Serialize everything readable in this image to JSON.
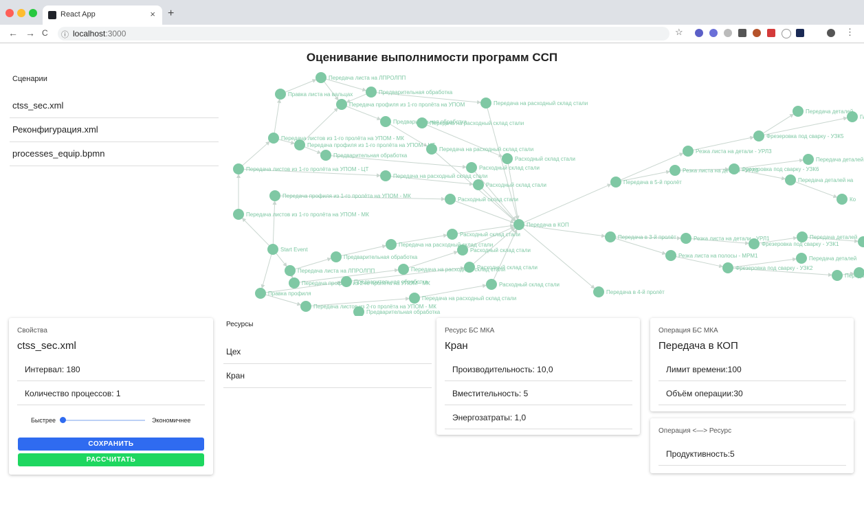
{
  "browser": {
    "tab_title": "React App",
    "url_host": "localhost",
    "url_port": ":3000",
    "tab_close": "×",
    "new_tab": "+",
    "back": "←",
    "forward": "→",
    "reload": "C",
    "info": "ⓘ",
    "star": "☆",
    "menu": "⋮"
  },
  "page": {
    "title": "Оценивание выполнимости программ ССП"
  },
  "scenarios": {
    "heading": "Сценарии",
    "items": [
      "ctss_sec.xml",
      "Реконфигурация.xml",
      "processes_equip.bpmn"
    ]
  },
  "graph": {
    "color": "#7fc8a4",
    "nodes": [
      {
        "label": "Передача листа на ЛПРОЛПП"
      },
      {
        "label": "Правка листа на вальцах"
      },
      {
        "label": "Предварительная обработка"
      },
      {
        "label": "Передача профиля из 1-го пролёта на УПОМ"
      },
      {
        "label": "Передача на расходный склад стали"
      },
      {
        "label": "Предварительная обработка"
      },
      {
        "label": "Передача на расходный склад стали"
      },
      {
        "label": "Передача листов из 1-го пролёта на УПОМ - МК"
      },
      {
        "label": "Передача профиля из 1-го пролёта на УПОМ - ЦТ"
      },
      {
        "label": "Предварительная обработка"
      },
      {
        "label": "Передача на расходный склад стали"
      },
      {
        "label": "Расходный склад стали"
      },
      {
        "label": "Расходный склад стали"
      },
      {
        "label": "Передача листов из 1-го пролёта на УПОМ - ЦТ"
      },
      {
        "label": "Передача на расходный склад стали"
      },
      {
        "label": "Расходный склад стали"
      },
      {
        "label": "Передача профиля из 1-го пролёта на УПОМ - МК"
      },
      {
        "label": "Расходный склад стали"
      },
      {
        "label": "Передача листов из 1-го пролёта на УПОМ - МК"
      },
      {
        "label": "Передача в КОП"
      },
      {
        "label": "Start Event"
      },
      {
        "label": "Расходный склад стали"
      },
      {
        "label": "Передача на расходный склад стали"
      },
      {
        "label": "Расходный склад стали"
      },
      {
        "label": "Предварительная обработка"
      },
      {
        "label": "Передача листа на ЛПРОЛПП"
      },
      {
        "label": "Передача на расходный склад стали"
      },
      {
        "label": "Расходный склад стали"
      },
      {
        "label": "Передача профиля из 2-го пролёта на УПОМ - МК"
      },
      {
        "label": "Предварительная обработка"
      },
      {
        "label": "Правка профиля"
      },
      {
        "label": "Расходный склад стали"
      },
      {
        "label": "Передача на расходный склад стали"
      },
      {
        "label": "Передача листов из 2-го пролёта на УПОМ - МК"
      },
      {
        "label": "Предварительная обработка"
      },
      {
        "label": "Передача в 5-й пролёт"
      },
      {
        "label": "Резка листа на детали - УРЛ3"
      },
      {
        "label": "Резка листа на детали - УРЛ2"
      },
      {
        "label": "Фрезеровка под сварку - УЗК5"
      },
      {
        "label": "Фрезеровка под сварку - УЗК6"
      },
      {
        "label": "Передача деталей"
      },
      {
        "label": "Передача деталей"
      },
      {
        "label": "Передача деталей на"
      },
      {
        "label": "Ко"
      },
      {
        "label": "Гиб"
      },
      {
        "label": "Передача в 3-й пролёт"
      },
      {
        "label": "Резка листа на детали - УРЛ1"
      },
      {
        "label": "Резка листа на полосы - МРМ1"
      },
      {
        "label": "Фрезеровка под сварку - УЗК1"
      },
      {
        "label": "Фрезеровка под сварку - УЗК2"
      },
      {
        "label": "Передача деталей"
      },
      {
        "label": "Передача деталей"
      },
      {
        "label": "Передача деталей на У"
      },
      {
        "label": "Ги"
      },
      {
        "label": "Ком"
      },
      {
        "label": "Передача в 4-й пролёт"
      }
    ]
  },
  "properties": {
    "caption": "Свойства",
    "title": "ctss_sec.xml",
    "interval": "Интервал: 180",
    "process_count": "Количество процессов: 1",
    "slider_left": "Быстрее",
    "slider_right": "Экономичнее",
    "slider_value": 0,
    "save_label": "СОХРАНИТЬ",
    "calc_label": "РАССЧИТАТЬ",
    "save_color": "#2f6bf0",
    "calc_color": "#1ed760"
  },
  "resources": {
    "heading": "Ресурсы",
    "items": [
      "Цех",
      "Кран"
    ]
  },
  "resource_detail": {
    "caption": "Ресурс БС МКА",
    "title": "Кран",
    "rows": [
      "Производительность: 10,0",
      "Вместительность: 5",
      "Энергозатраты: 1,0"
    ]
  },
  "operation": {
    "caption": "Операция БС МКА",
    "title": "Передача в КОП",
    "rows": [
      "Лимит времени:100",
      "Объём операции:30"
    ]
  },
  "op_resource": {
    "caption": "Операция <—> Ресурс",
    "rows": [
      "Продуктивность:5"
    ]
  }
}
